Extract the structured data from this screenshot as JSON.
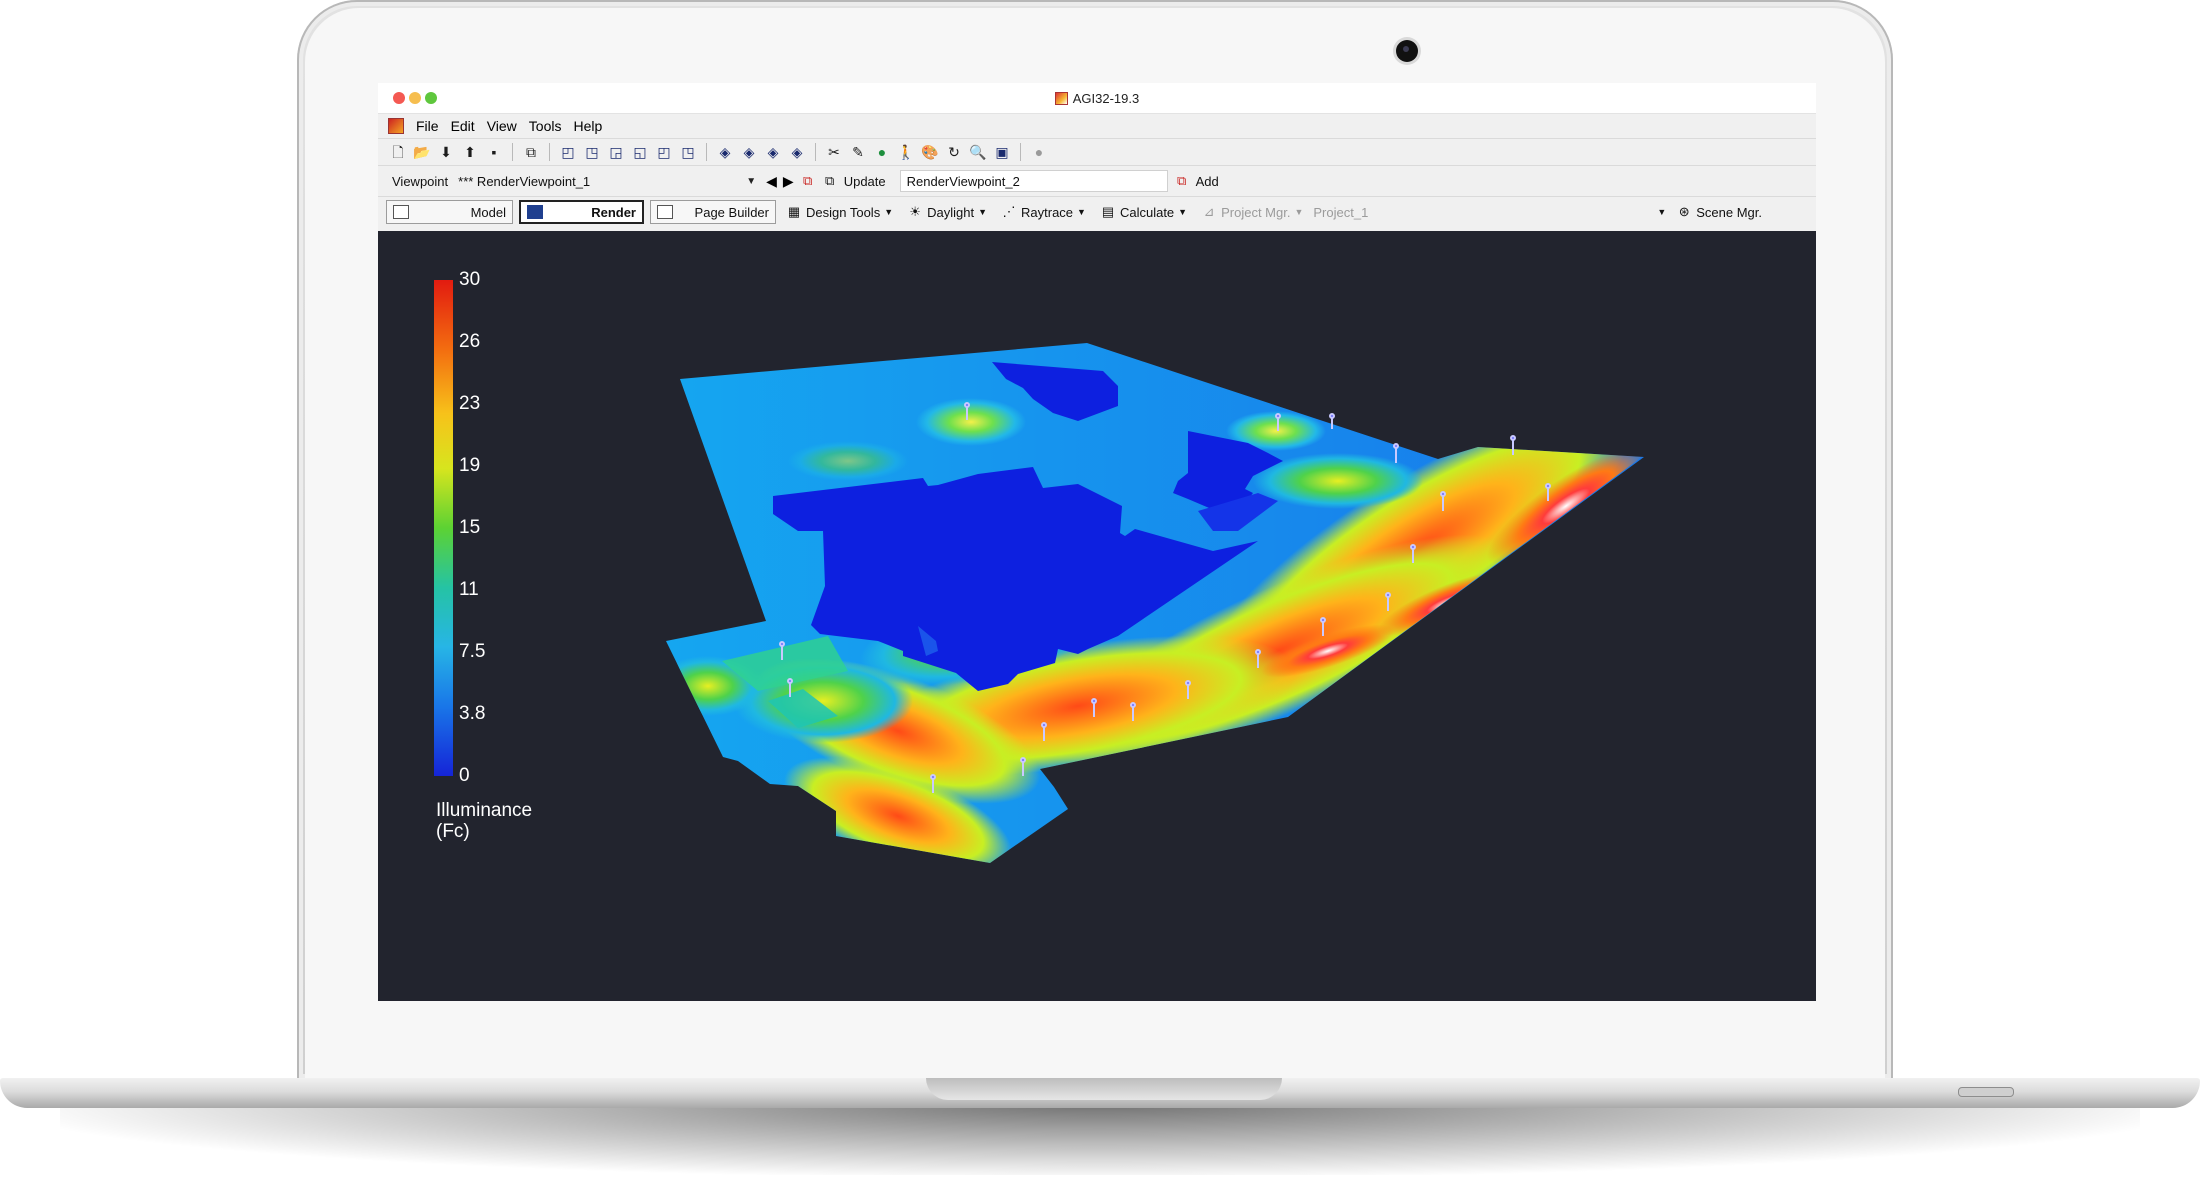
{
  "window": {
    "title": "AGI32-19.3"
  },
  "menu": [
    "File",
    "Edit",
    "View",
    "Tools",
    "Help"
  ],
  "toolbar_icons": [
    "new-file-icon",
    "open-folder-icon",
    "import-icon",
    "export-icon",
    "save-icon",
    "copy-icon",
    "cube-view-1-icon",
    "cube-view-2-icon",
    "cube-view-3-icon",
    "cube-view-4-icon",
    "cube-view-5-icon",
    "cube-view-6-icon",
    "orbit-1-icon",
    "orbit-2-icon",
    "orbit-3-icon",
    "orbit-4-icon",
    "scissors-icon",
    "paste-icon",
    "globe-icon",
    "walk-icon",
    "paint-icon",
    "refresh-icon",
    "zoom-icon",
    "display-icon",
    "stop-icon"
  ],
  "viewpoint": {
    "label": "Viewpoint",
    "current": "*** RenderViewpoint_1",
    "update_label": "Update",
    "new_name": "RenderViewpoint_2",
    "add_label": "Add"
  },
  "modes": {
    "model": "Model",
    "render": "Render",
    "page_builder": "Page Builder",
    "design_tools": "Design Tools",
    "daylight": "Daylight",
    "raytrace": "Raytrace",
    "calculate": "Calculate",
    "project_mgr": "Project Mgr.",
    "project_name": "Project_1",
    "scene_mgr": "Scene Mgr."
  },
  "legend": {
    "title_line1": "Illuminance",
    "title_line2": "(Fc)",
    "ticks": [
      "30",
      "26",
      "23",
      "19",
      "15",
      "11",
      "7.5",
      "3.8",
      "0"
    ],
    "scale_min": 0,
    "scale_max": 30,
    "colors": {
      "high": "#e21b10",
      "mid": "#5cd233",
      "low": "#1524d7"
    }
  },
  "colors": {
    "viewport_background": "#22242e",
    "window_background": "#f0f0f0"
  }
}
